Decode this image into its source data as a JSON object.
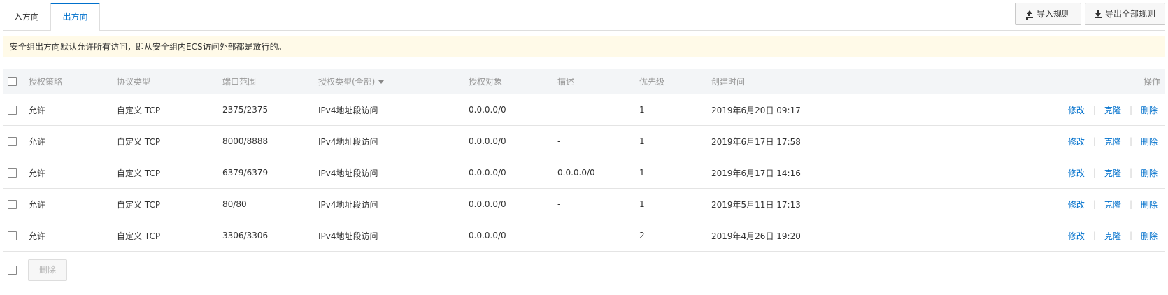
{
  "tabs": [
    {
      "label": "入方向",
      "active": false
    },
    {
      "label": "出方向",
      "active": true
    }
  ],
  "toolbar": {
    "import_label": "导入规则",
    "export_label": "导出全部规则"
  },
  "notice": {
    "text": "安全组出方向默认允许所有访问，即从安全组内ECS访问外部都是放行的。"
  },
  "table": {
    "headers": {
      "policy": "授权策略",
      "protocol": "协议类型",
      "port": "端口范围",
      "auth_type": "授权类型(全部)",
      "object": "授权对象",
      "description": "描述",
      "priority": "优先级",
      "created": "创建时间",
      "actions": "操作"
    },
    "rows": [
      {
        "policy": "允许",
        "protocol": "自定义 TCP",
        "port": "2375/2375",
        "auth_type": "IPv4地址段访问",
        "object": "0.0.0.0/0",
        "description": "-",
        "priority": "1",
        "created": "2019年6月20日 09:17"
      },
      {
        "policy": "允许",
        "protocol": "自定义 TCP",
        "port": "8000/8888",
        "auth_type": "IPv4地址段访问",
        "object": "0.0.0.0/0",
        "description": "-",
        "priority": "1",
        "created": "2019年6月17日 17:58"
      },
      {
        "policy": "允许",
        "protocol": "自定义 TCP",
        "port": "6379/6379",
        "auth_type": "IPv4地址段访问",
        "object": "0.0.0.0/0",
        "description": "0.0.0.0/0",
        "priority": "1",
        "created": "2019年6月17日 14:16"
      },
      {
        "policy": "允许",
        "protocol": "自定义 TCP",
        "port": "80/80",
        "auth_type": "IPv4地址段访问",
        "object": "0.0.0.0/0",
        "description": "-",
        "priority": "1",
        "created": "2019年5月11日 17:13"
      },
      {
        "policy": "允许",
        "protocol": "自定义 TCP",
        "port": "3306/3306",
        "auth_type": "IPv4地址段访问",
        "object": "0.0.0.0/0",
        "description": "-",
        "priority": "2",
        "created": "2019年4月26日 19:20"
      }
    ],
    "row_actions": {
      "edit": "修改",
      "clone": "克隆",
      "delete": "删除"
    },
    "bulk_delete_label": "删除"
  }
}
